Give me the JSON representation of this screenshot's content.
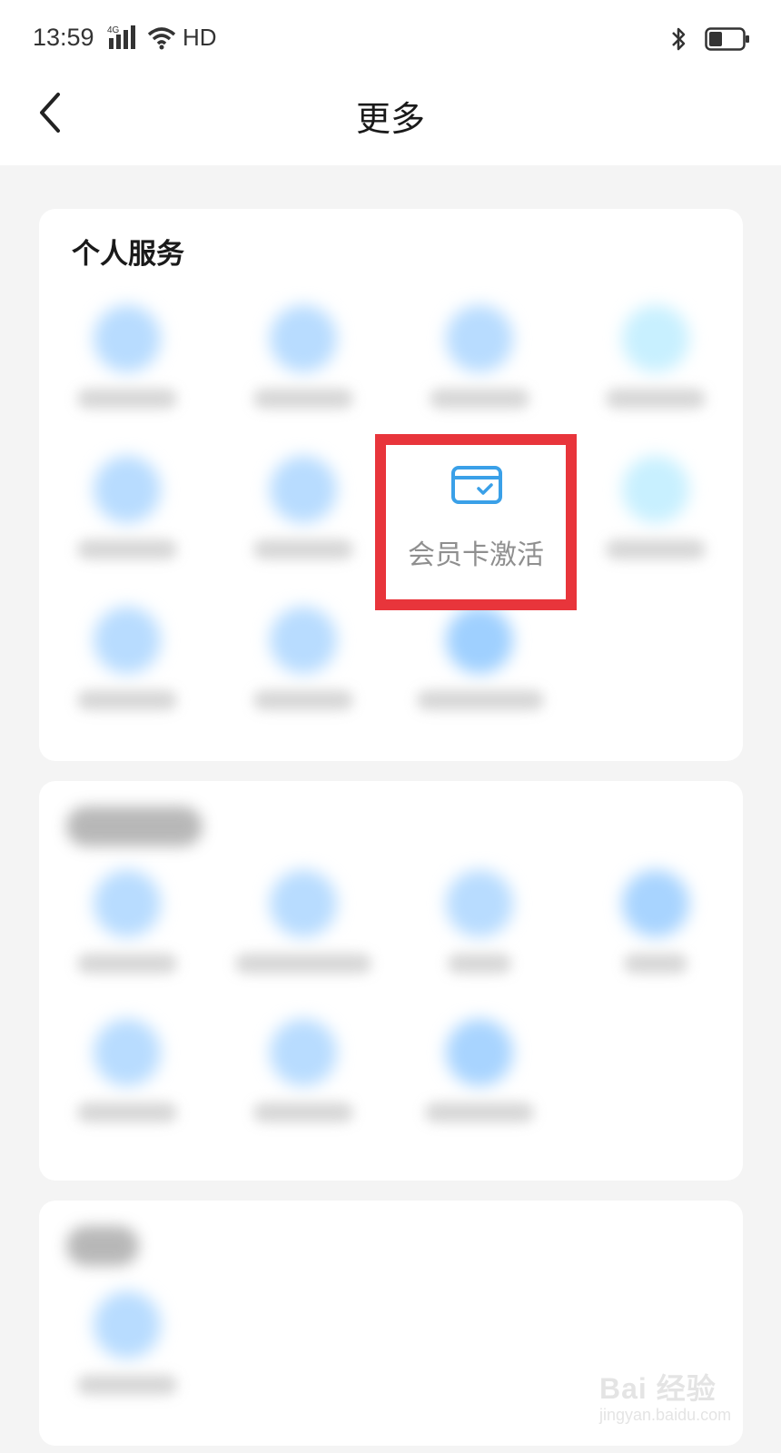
{
  "status_bar": {
    "time": "13:59",
    "network": "4G",
    "hd": "HD"
  },
  "header": {
    "title": "更多"
  },
  "personal_services": {
    "title": "个人服务",
    "highlighted_item": {
      "label": "会员卡激活",
      "icon": "membership-card-icon"
    }
  },
  "watermark": {
    "main": "Bai 经验",
    "sub": "jingyan.baidu.com"
  },
  "colors": {
    "highlight_border": "#e8353b",
    "icon_blue": "#3aa0e8",
    "background": "#f4f4f4"
  }
}
